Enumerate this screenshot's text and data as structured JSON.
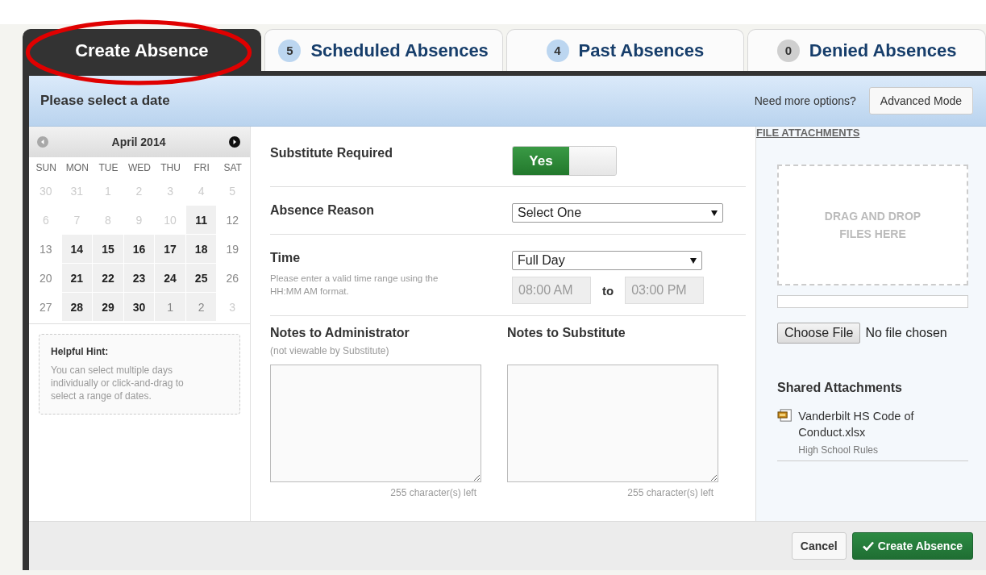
{
  "tabs": [
    {
      "label": "Create Absence",
      "selected": true,
      "circled": true
    },
    {
      "count": "5",
      "label": "Scheduled Absences",
      "selected": false,
      "circled": false,
      "color": "#bcd6f0"
    },
    {
      "count": "4",
      "label": "Past Absences",
      "selected": false,
      "circled": false,
      "color": "#bcd6f0"
    },
    {
      "count": "0",
      "label": "Denied Absences",
      "selected": false,
      "circled": false,
      "color": "#cfcfcf"
    }
  ],
  "header": {
    "title": "Please select a date",
    "prompt": "Need more options?",
    "button": "Advanced Mode"
  },
  "calendar": {
    "month": "April 2014",
    "prev_disabled": true,
    "next_disabled": false,
    "weekdays": [
      "SUN",
      "MON",
      "TUE",
      "WED",
      "THU",
      "FRI",
      "SAT"
    ],
    "weeks": [
      [
        {
          "day": "30",
          "kind": "disabled"
        },
        {
          "day": "31",
          "kind": "disabled"
        },
        {
          "day": "1",
          "kind": "disabled"
        },
        {
          "day": "2",
          "kind": "disabled"
        },
        {
          "day": "3",
          "kind": "disabled"
        },
        {
          "day": "4",
          "kind": "disabled"
        },
        {
          "day": "5",
          "kind": "disabled"
        }
      ],
      [
        {
          "day": "6",
          "kind": "disabled"
        },
        {
          "day": "7",
          "kind": "disabled"
        },
        {
          "day": "8",
          "kind": "disabled"
        },
        {
          "day": "9",
          "kind": "disabled"
        },
        {
          "day": "10",
          "kind": "disabled"
        },
        {
          "day": "11",
          "kind": "available"
        },
        {
          "day": "12",
          "kind": "weekend"
        }
      ],
      [
        {
          "day": "13",
          "kind": "weekend"
        },
        {
          "day": "14",
          "kind": "available"
        },
        {
          "day": "15",
          "kind": "available"
        },
        {
          "day": "16",
          "kind": "available"
        },
        {
          "day": "17",
          "kind": "available"
        },
        {
          "day": "18",
          "kind": "available"
        },
        {
          "day": "19",
          "kind": "weekend"
        }
      ],
      [
        {
          "day": "20",
          "kind": "weekend"
        },
        {
          "day": "21",
          "kind": "available"
        },
        {
          "day": "22",
          "kind": "available"
        },
        {
          "day": "23",
          "kind": "available"
        },
        {
          "day": "24",
          "kind": "available"
        },
        {
          "day": "25",
          "kind": "available"
        },
        {
          "day": "26",
          "kind": "weekend"
        }
      ],
      [
        {
          "day": "27",
          "kind": "weekend"
        },
        {
          "day": "28",
          "kind": "available"
        },
        {
          "day": "29",
          "kind": "available"
        },
        {
          "day": "30",
          "kind": "available"
        },
        {
          "day": "1",
          "kind": "next"
        },
        {
          "day": "2",
          "kind": "next"
        },
        {
          "day": "3",
          "kind": "disabled"
        }
      ]
    ]
  },
  "hint": {
    "title": "Helpful Hint:",
    "text": "You can select multiple days individually or click-and-drag to select a range of dates."
  },
  "form": {
    "substitute": {
      "label": "Substitute Required",
      "toggle": "Yes",
      "on": true
    },
    "reason": {
      "label": "Absence Reason",
      "value": "Select One"
    },
    "time": {
      "label": "Time",
      "help": "Please enter a valid time range using the HH:MM AM format.",
      "value": "Full Day",
      "from": "08:00 AM",
      "separator": "to",
      "to": "03:00 PM"
    },
    "notes": [
      {
        "label": "Notes to Administrator",
        "sub": "(not viewable by Substitute)",
        "counter": "255 character(s) left"
      },
      {
        "label": "Notes to Substitute",
        "counter": "255 character(s) left"
      }
    ]
  },
  "attachments": {
    "title": "FILE ATTACHMENTS",
    "drop": "DRAG AND DROP FILES HERE",
    "choose": "Choose File",
    "no_file": "No file chosen",
    "shared_title": "Shared Attachments",
    "files": [
      {
        "name": "Vanderbilt HS Code of Conduct.xlsx",
        "description": "High School Rules"
      }
    ]
  },
  "footer": {
    "cancel": "Cancel",
    "submit": "Create Absence"
  }
}
